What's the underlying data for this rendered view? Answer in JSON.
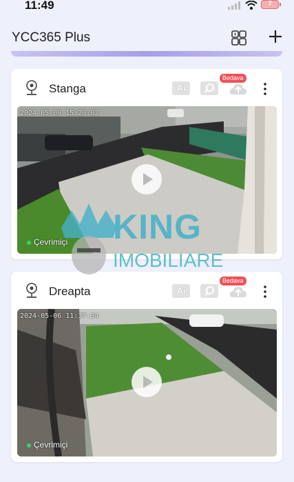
{
  "status_bar": {
    "time": "11:49",
    "battery": "7"
  },
  "header": {
    "title": "YCC365 Plus"
  },
  "cameras": [
    {
      "name": "Stanga",
      "ai_label": "Ai",
      "badge": "Bedava",
      "timestamp": "2024-05-09 15:20:02",
      "status": "Çevrimiçi"
    },
    {
      "name": "Dreapta",
      "ai_label": "Ai",
      "badge": "Bedava",
      "timestamp": "2024-05-06 11:37:34",
      "status": "Çevrimiçi"
    }
  ],
  "watermark": {
    "line1": "KING",
    "line2": "IMOBILIARE"
  },
  "colors": {
    "online": "#38d36a",
    "badge": "#f0505a",
    "background": "#eef0fb"
  }
}
